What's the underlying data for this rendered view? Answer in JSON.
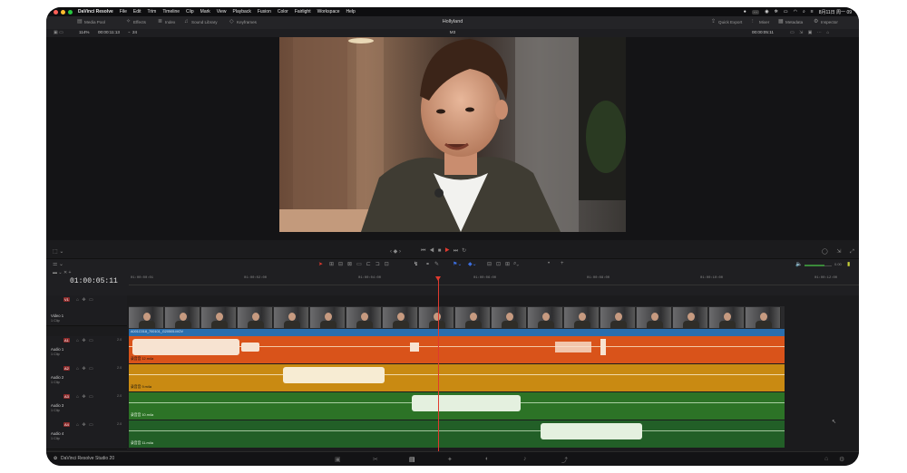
{
  "menubar": {
    "app_name": "DaVinci Resolve",
    "items": [
      "File",
      "Edit",
      "Trim",
      "Timeline",
      "Clip",
      "Mark",
      "View",
      "Playback",
      "Fusion",
      "Color",
      "Fairlight",
      "Workspace",
      "Help"
    ],
    "date": "8月11日 周一 09"
  },
  "toolbar": {
    "media_pool": "Media Pool",
    "effects": "Effects",
    "index": "Index",
    "sound_library": "Sound Library",
    "keyframes": "Keyframes",
    "project_title": "Hollyland",
    "quick_export": "Quick Export",
    "mixer": "Mixer",
    "metadata": "Metadata",
    "inspector": "Inspector"
  },
  "viewer": {
    "zoom": "114%",
    "source_timecode": "00:00:11:13",
    "fps": "24",
    "clip_name": "M3",
    "timecode_right": "00:00:05:11"
  },
  "timeline": {
    "current_timecode": "01:00:05:11",
    "ruler_labels": [
      "01:00:00:01",
      "01:00:02:00",
      "01:00:04:00",
      "01:00:06:00",
      "01:00:08:00",
      "01:00:10:00",
      "01:00:12:00"
    ],
    "volume_label": "0.00"
  },
  "tracks": [
    {
      "id": "V1",
      "name": "Video 1",
      "sub": "1 Clip",
      "color": "#d9534f",
      "clip_label": "A001C018_700101_G20505.MOV"
    },
    {
      "id": "A1",
      "name": "Audio 1",
      "sub": "1 Clip",
      "level": "2.0",
      "color": "#e0551a",
      "clip_label": "录音音 12.m4a"
    },
    {
      "id": "A2",
      "name": "Audio 2",
      "sub": "1 Clip",
      "level": "2.0",
      "color": "#c98a12",
      "clip_label": "录音音 9.m4a"
    },
    {
      "id": "A3",
      "name": "Audio 3",
      "sub": "1 Clip",
      "level": "2.0",
      "color": "#2f7a2a",
      "clip_label": "录音音 10.m4a"
    },
    {
      "id": "A4",
      "name": "Audio 4",
      "sub": "1 Clip",
      "level": "2.0",
      "color": "#236b2a",
      "clip_label": "录音音 11.m4a"
    }
  ],
  "bottombar": {
    "app_version": "DaVinci Resolve Studio 20"
  },
  "colors": {
    "accent_red": "#e03a2f",
    "a1_orange": "#d9531a",
    "a2_yellow": "#c98a12",
    "a3_green": "#2c7326",
    "a4_green": "#225f27",
    "video_blue": "#2a6ead"
  }
}
